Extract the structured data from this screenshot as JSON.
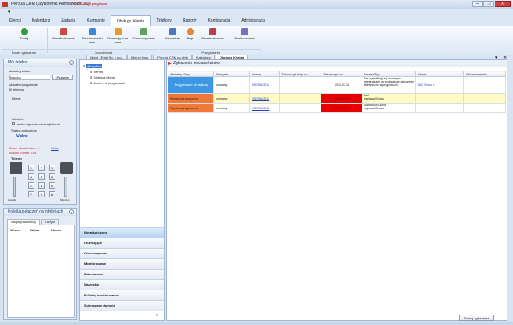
{
  "window": {
    "title": "Percula CRM (użytkownik: Admin Nnoo CC)",
    "alert": "• ZGŁOSZENIA przypisane"
  },
  "menu": [
    "Klienci",
    "Kalendarz",
    "Zadania",
    "Kampanie",
    "Obsługa klienta",
    "Telefony",
    "Raporty",
    "Konfiguracja",
    "Administracja"
  ],
  "ribbon": {
    "add": "Dodaj",
    "group_new": "Nowe zgłoszenie",
    "b1": "Niezakończone",
    "b2": "Skierowane do mnie",
    "b3": "Oczekujące na mnie",
    "b4": "Opracowywane",
    "group_todo": "Do zrobienia",
    "b5": "Wszystkie",
    "b6": "Moje",
    "b7": "Niezakończone",
    "b8": "Monitorowane",
    "group_view": "Przeglądanie"
  },
  "doc_tabs": [
    "Klient - Entel Sp. z o.o.",
    "Klienci firmy",
    "Percula CRM na dziś",
    "Kalendarz",
    "Obsługa Klienta"
  ],
  "phone": {
    "title": "Mój telefon",
    "status_label": "Aktualny status:",
    "status_value": "kokoko",
    "status_btn": "Pozwnia",
    "conn_label": "Aktualne połączenie",
    "conn_sub": "Ni telefonu",
    "client_label": "Klient:",
    "info_label": "Infolinia:",
    "auto_label": "Automatycznie otwieraj klienta",
    "conn_status_label": "Status połączenia",
    "conn_status_value": "Wolne",
    "missed": "Nowe nieodebrane: 0",
    "missed_link": "Lista",
    "callback": "Dzwoni numer: 104",
    "phone_label": "Telefon",
    "keys": [
      "1",
      "2",
      "3",
      "4",
      "5",
      "6",
      "7",
      "8",
      "9",
      "*",
      "0",
      "#"
    ],
    "vol_left": "Głośnik",
    "vol_right": "Mikrofon"
  },
  "queue": {
    "title": "Kolejka połączeń na infoliniach",
    "tab1": "Współpracownicy",
    "tab2": "Kolejki",
    "cols": [
      "Wewn.",
      "Status",
      "Numer"
    ]
  },
  "tree": {
    "root": "Wszystkie",
    "items": [
      "Serwis",
      "Obsługa klienta",
      "Zmiany w programach"
    ]
  },
  "sidebar": [
    "Niezakończone",
    "Oczekujące",
    "Opracowywane",
    "Monitorowane",
    "Zakończone",
    "Wszystkie",
    "Definiuj monitorowane",
    "Skierowane do mnie"
  ],
  "main": {
    "title": "Zgłoszenia niezakończone",
    "columns": [
      "Aktualny Etap",
      "Priorytet",
      "Numer",
      "Zakończył etap do",
      "Zakończyć do",
      "Nazwa/Typ",
      "Klient",
      "Skierowane do"
    ],
    "rows": [
      {
        "etap": "Przygotowanie do realizacji",
        "priorytet": "normalny",
        "numer": "3/SERW/2012",
        "zak_etap": "",
        "zak_do": "2012-07-18",
        "nazwa": "Nie wyświetlają się numery w rejestracjach na wydawnicze",
        "klient": "ABC Spzoo s.",
        "skierowane": ""
      },
      {
        "etap": "Rejestracja zgłoszenia",
        "priorytet": "normalny",
        "numer": "2/SERW/2012",
        "zak_etap": "",
        "zak_do": "2012-07-17",
        "nazwa": "test",
        "klient": "",
        "skierowane": ""
      },
      {
        "etap": "Rejestracja zgłoszenia",
        "priorytet": "normalny",
        "numer": "1/SERW/2012",
        "zak_etap": "",
        "zak_do": "2012-07-16",
        "nazwa": "uszkodzona karta",
        "klient": "",
        "skierowane": ""
      }
    ],
    "row1_line2": "zgłoszenie telefoniczne w",
    "row1_line3": "programach",
    "row2_line2": "naprawa/Serwis",
    "row3_line2": "naprawa/Serwis"
  },
  "footer_button": "Drukuj zgłoszenia",
  "colors": {
    "etap_blue": "#3d97e3",
    "etap_orange": "#f0793a",
    "red": "#e60000",
    "yellow": "#fffbc4"
  }
}
